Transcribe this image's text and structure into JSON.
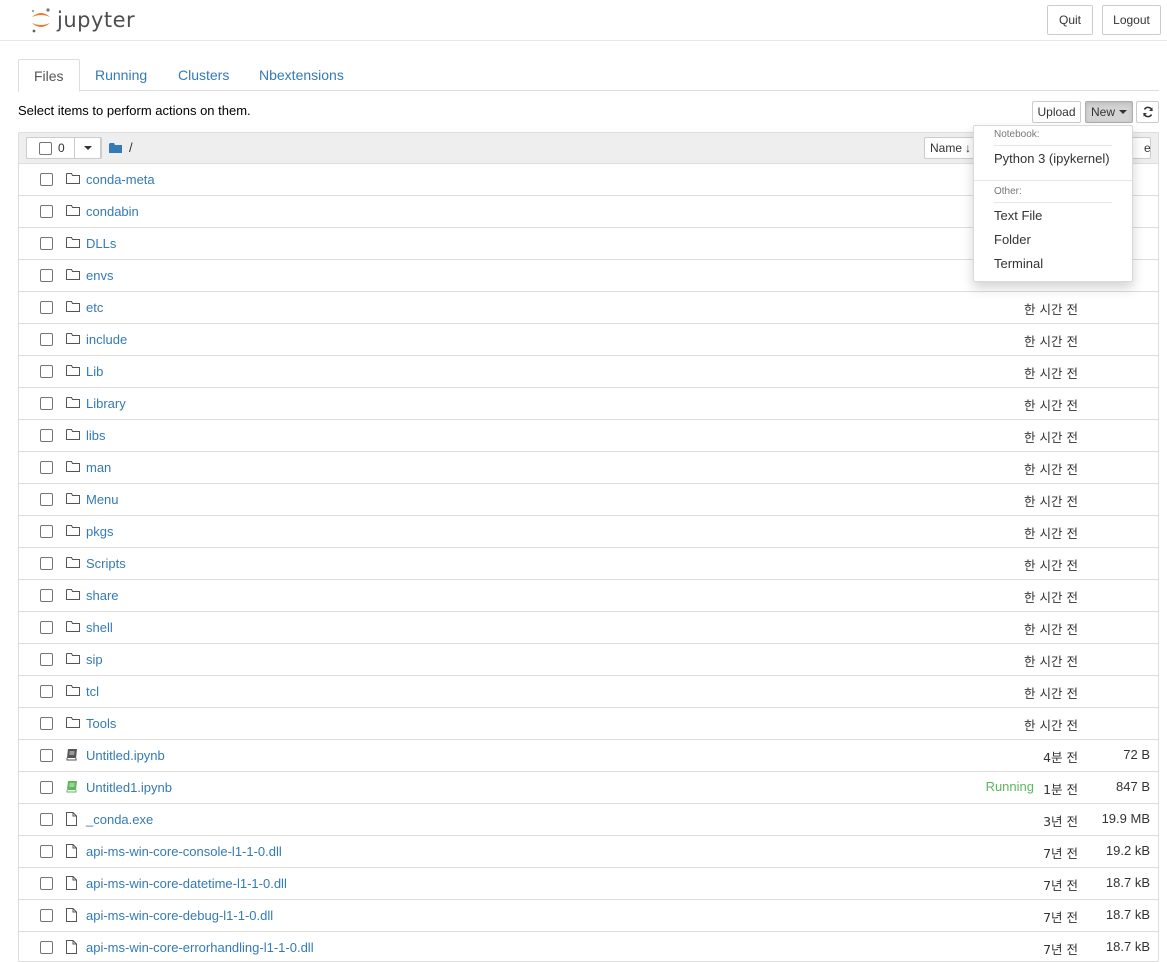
{
  "header": {
    "logo_text": "jupyter",
    "quit_label": "Quit",
    "logout_label": "Logout"
  },
  "tabs": [
    {
      "label": "Files",
      "active": true
    },
    {
      "label": "Running",
      "active": false
    },
    {
      "label": "Clusters",
      "active": false
    },
    {
      "label": "Nbextensions",
      "active": false
    }
  ],
  "toolbar": {
    "select_message": "Select items to perform actions on them.",
    "upload_label": "Upload",
    "new_label": "New",
    "refresh_icon": "refresh-icon"
  },
  "list_header": {
    "selected_count": "0",
    "breadcrumb_root": "/",
    "sort_name_label": "Name",
    "last_modified_label_fragment": "e"
  },
  "new_menu": {
    "notebook_header": "Notebook:",
    "notebook_item": "Python 3 (ipykernel)",
    "other_header": "Other:",
    "other_items": [
      "Text File",
      "Folder",
      "Terminal"
    ]
  },
  "files": [
    {
      "name": "conda-meta",
      "type": "folder",
      "time": "",
      "size": "",
      "running": ""
    },
    {
      "name": "condabin",
      "type": "folder",
      "time": "",
      "size": "",
      "running": ""
    },
    {
      "name": "DLLs",
      "type": "folder",
      "time": "",
      "size": "",
      "running": ""
    },
    {
      "name": "envs",
      "type": "folder",
      "time": "",
      "size": "",
      "running": ""
    },
    {
      "name": "etc",
      "type": "folder",
      "time": "한 시간 전",
      "size": "",
      "running": ""
    },
    {
      "name": "include",
      "type": "folder",
      "time": "한 시간 전",
      "size": "",
      "running": ""
    },
    {
      "name": "Lib",
      "type": "folder",
      "time": "한 시간 전",
      "size": "",
      "running": ""
    },
    {
      "name": "Library",
      "type": "folder",
      "time": "한 시간 전",
      "size": "",
      "running": ""
    },
    {
      "name": "libs",
      "type": "folder",
      "time": "한 시간 전",
      "size": "",
      "running": ""
    },
    {
      "name": "man",
      "type": "folder",
      "time": "한 시간 전",
      "size": "",
      "running": ""
    },
    {
      "name": "Menu",
      "type": "folder",
      "time": "한 시간 전",
      "size": "",
      "running": ""
    },
    {
      "name": "pkgs",
      "type": "folder",
      "time": "한 시간 전",
      "size": "",
      "running": ""
    },
    {
      "name": "Scripts",
      "type": "folder",
      "time": "한 시간 전",
      "size": "",
      "running": ""
    },
    {
      "name": "share",
      "type": "folder",
      "time": "한 시간 전",
      "size": "",
      "running": ""
    },
    {
      "name": "shell",
      "type": "folder",
      "time": "한 시간 전",
      "size": "",
      "running": ""
    },
    {
      "name": "sip",
      "type": "folder",
      "time": "한 시간 전",
      "size": "",
      "running": ""
    },
    {
      "name": "tcl",
      "type": "folder",
      "time": "한 시간 전",
      "size": "",
      "running": ""
    },
    {
      "name": "Tools",
      "type": "folder",
      "time": "한 시간 전",
      "size": "",
      "running": ""
    },
    {
      "name": "Untitled.ipynb",
      "type": "notebook",
      "time": "4분 전",
      "size": "72 B",
      "running": ""
    },
    {
      "name": "Untitled1.ipynb",
      "type": "notebook-running",
      "time": "1분 전",
      "size": "847 B",
      "running": "Running"
    },
    {
      "name": "_conda.exe",
      "type": "file",
      "time": "3년 전",
      "size": "19.9 MB",
      "running": ""
    },
    {
      "name": "api-ms-win-core-console-l1-1-0.dll",
      "type": "file",
      "time": "7년 전",
      "size": "19.2 kB",
      "running": ""
    },
    {
      "name": "api-ms-win-core-datetime-l1-1-0.dll",
      "type": "file",
      "time": "7년 전",
      "size": "18.7 kB",
      "running": ""
    },
    {
      "name": "api-ms-win-core-debug-l1-1-0.dll",
      "type": "file",
      "time": "7년 전",
      "size": "18.7 kB",
      "running": ""
    },
    {
      "name": "api-ms-win-core-errorhandling-l1-1-0.dll",
      "type": "file",
      "time": "7년 전",
      "size": "18.7 kB",
      "running": ""
    }
  ]
}
